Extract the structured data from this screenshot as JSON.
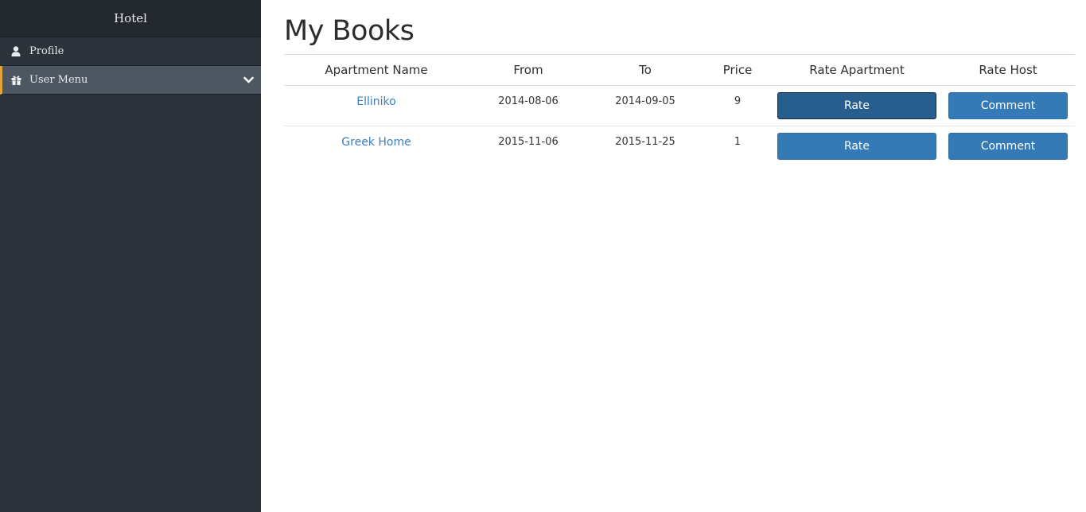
{
  "sidebar": {
    "title": "Hotel",
    "items": [
      {
        "label": "Profile",
        "icon": "user-icon"
      },
      {
        "label": "User Menu",
        "icon": "gift-icon",
        "expandable": true
      }
    ],
    "accent_color": "#e3a33b"
  },
  "main": {
    "title": "My Books",
    "table": {
      "headers": [
        "Apartment Name",
        "From",
        "To",
        "Price",
        "Rate Apartment",
        "Rate Host"
      ],
      "rows": [
        {
          "name": "Elliniko",
          "from": "2014-08-06",
          "to": "2014-09-05",
          "price": "9",
          "rate_label": "Rate",
          "comment_label": "Comment"
        },
        {
          "name": "Greek Home",
          "from": "2015-11-06",
          "to": "2015-11-25",
          "price": "1",
          "rate_label": "Rate",
          "comment_label": "Comment"
        }
      ]
    },
    "button_color": "#337ab7",
    "link_color": "#3b7fc0"
  }
}
